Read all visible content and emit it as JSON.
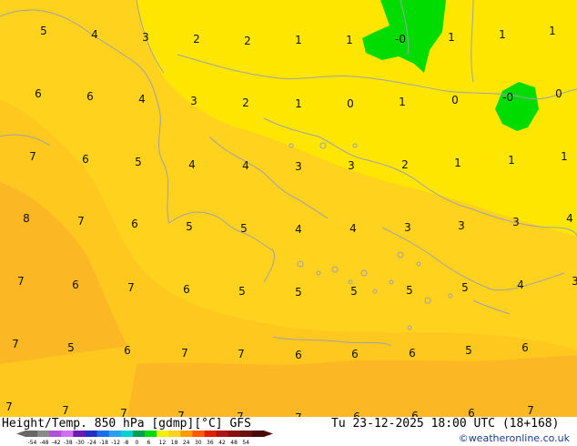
{
  "map": {
    "colors": {
      "lighter_yellow": "#ffe600",
      "yellow": "#ffd21e",
      "orange_yellow": "#ffc81e",
      "orange": "#fbb724",
      "green": "#00dc00",
      "coast": "#a0a0b0"
    },
    "temperature_labels": [
      {
        "text": "5"
      },
      {
        "text": "4"
      },
      {
        "text": "3"
      },
      {
        "text": "2"
      },
      {
        "text": "2"
      },
      {
        "text": "1"
      },
      {
        "text": "1"
      },
      {
        "text": "-0"
      },
      {
        "text": "1"
      },
      {
        "text": "1"
      },
      {
        "text": "1"
      },
      {
        "text": "6"
      },
      {
        "text": "6"
      },
      {
        "text": "4"
      },
      {
        "text": "3"
      },
      {
        "text": "2"
      },
      {
        "text": "1"
      },
      {
        "text": "0"
      },
      {
        "text": "1"
      },
      {
        "text": "0"
      },
      {
        "text": "-0"
      },
      {
        "text": "0"
      },
      {
        "text": "7"
      },
      {
        "text": "6"
      },
      {
        "text": "5"
      },
      {
        "text": "4"
      },
      {
        "text": "4"
      },
      {
        "text": "3"
      },
      {
        "text": "3"
      },
      {
        "text": "2"
      },
      {
        "text": "1"
      },
      {
        "text": "1"
      },
      {
        "text": "1"
      },
      {
        "text": "8"
      },
      {
        "text": "7"
      },
      {
        "text": "6"
      },
      {
        "text": "5"
      },
      {
        "text": "5"
      },
      {
        "text": "4"
      },
      {
        "text": "4"
      },
      {
        "text": "3"
      },
      {
        "text": "3"
      },
      {
        "text": "3"
      },
      {
        "text": "4"
      },
      {
        "text": "7"
      },
      {
        "text": "6"
      },
      {
        "text": "7"
      },
      {
        "text": "6"
      },
      {
        "text": "5"
      },
      {
        "text": "5"
      },
      {
        "text": "5"
      },
      {
        "text": "5"
      },
      {
        "text": "5"
      },
      {
        "text": "4"
      },
      {
        "text": "3"
      },
      {
        "text": "7"
      },
      {
        "text": "5"
      },
      {
        "text": "6"
      },
      {
        "text": "7"
      },
      {
        "text": "7"
      },
      {
        "text": "6"
      },
      {
        "text": "6"
      },
      {
        "text": "6"
      },
      {
        "text": "5"
      },
      {
        "text": "6"
      },
      {
        "text": "7"
      },
      {
        "text": "7"
      },
      {
        "text": "7"
      },
      {
        "text": "7"
      },
      {
        "text": "7"
      },
      {
        "text": "7"
      },
      {
        "text": "6"
      },
      {
        "text": "6"
      },
      {
        "text": "6"
      },
      {
        "text": "7"
      }
    ]
  },
  "footer": {
    "title_left": "Height/Temp. 850 hPa [gdmp][°C] GFS",
    "title_right": "Tu 23-12-2025 18:00 UTC (18+168)",
    "credit": "©weatheronline.co.uk",
    "scale_ticks": [
      "-54",
      "-48",
      "-42",
      "-38",
      "-30",
      "-24",
      "-18",
      "-12",
      "-8",
      "0",
      "6",
      "12",
      "18",
      "24",
      "30",
      "36",
      "42",
      "48",
      "54"
    ],
    "scale_colors": [
      "#666666",
      "#8a8a8a",
      "#b050d8",
      "#d070f0",
      "#6a1ab0",
      "#2030c8",
      "#1a6ee6",
      "#28a0f0",
      "#00d2d2",
      "#00a050",
      "#00dc00",
      "#f0f000",
      "#ffd21e",
      "#ff9a00",
      "#ff5a00",
      "#e02000",
      "#b01414",
      "#8a1010",
      "#6a0e0e",
      "#4a0a0a"
    ]
  }
}
